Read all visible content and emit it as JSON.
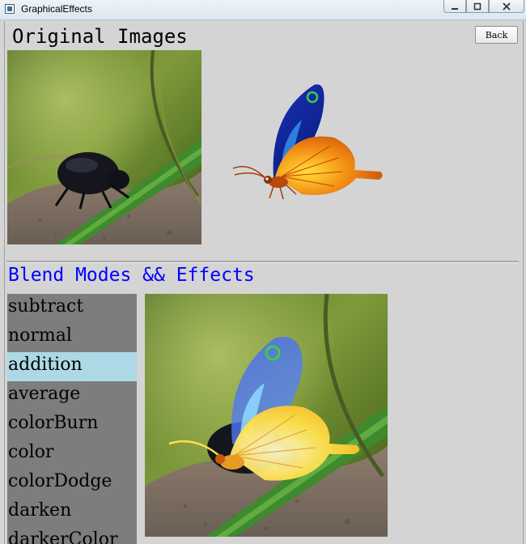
{
  "window": {
    "title": "GraphicalEffects",
    "controls": [
      "minimize",
      "maximize",
      "close"
    ]
  },
  "header": {
    "title": "Original Images",
    "back_label": "Back"
  },
  "images": {
    "source": "beetle-on-grass-photo",
    "mask": "butterfly-illustration",
    "result": "blended-beetle-butterfly"
  },
  "blend_section": {
    "title": "Blend Modes && Effects",
    "modes": [
      "subtract",
      "normal",
      "addition",
      "average",
      "colorBurn",
      "color",
      "colorDodge",
      "darken",
      "darkerColor"
    ],
    "selected": "addition"
  },
  "colors": {
    "background": "#d4d4d4",
    "list_background": "#7d7d7d",
    "selected_item": "#add8e6",
    "section_title": "#0000ff"
  }
}
